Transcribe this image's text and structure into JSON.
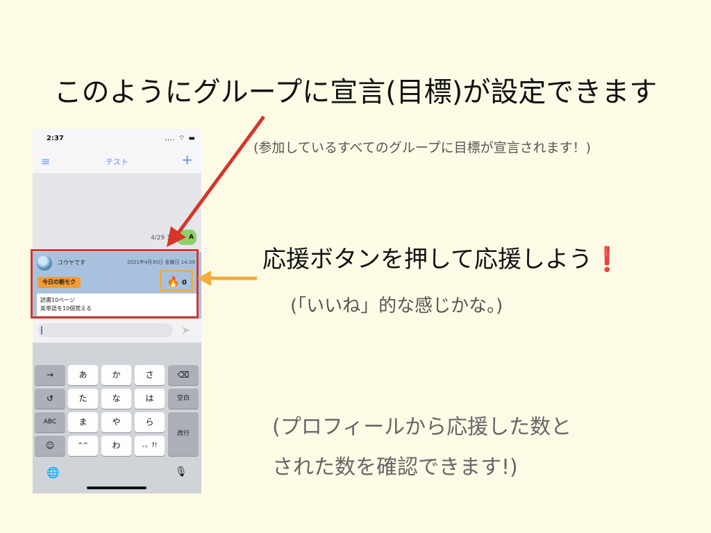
{
  "slide": {
    "main_title": "このようにグループに宣言(目標)が設定できます",
    "sub_note": "(参加しているすべてのグループに目標が宣言されます！)",
    "cheer_title": "応援ボタンを押して応援しよう",
    "cheer_exclaim": "❗",
    "cheer_note": "(「いいね」的な感じかな。)",
    "profile_note_line1": "(プロフィールから応援した数と",
    "profile_note_line2": "された数を確認できます!)",
    "colors": {
      "highlight_red": "#d6352a",
      "highlight_orange": "#f0ad3c",
      "background": "#fdfbe6"
    }
  },
  "phone": {
    "status_bar": {
      "time": "2:37",
      "icons": "…. ⌔ ▬"
    },
    "nav": {
      "title": "テスト",
      "menu_icon": "≡",
      "plus_icon": "+"
    },
    "chat": {
      "message_date": "4/29 1",
      "bubble_text": "A"
    },
    "goal_card": {
      "user_name": "ユウヤです",
      "date": "2021年4月30日 金曜日 14:39",
      "tag": "今日の朝モク",
      "flame_icon": "🔥",
      "cheer_count": "0",
      "goal_line1": "読書10ページ",
      "goal_line2": "英単語を10個覚える"
    },
    "input": {
      "placeholder": "",
      "send_icon": "➤"
    },
    "keyboard": {
      "row1": [
        "→",
        "あ",
        "か",
        "さ",
        "⌫"
      ],
      "row2": [
        "↺",
        "た",
        "な",
        "は",
        "空白"
      ],
      "row3": [
        "ABC",
        "ま",
        "や",
        "ら",
        "改行"
      ],
      "row4": [
        "☺",
        "^^",
        "わ",
        "、。?!"
      ],
      "globe_icon": "🌐",
      "mic_icon": "🎙"
    }
  }
}
